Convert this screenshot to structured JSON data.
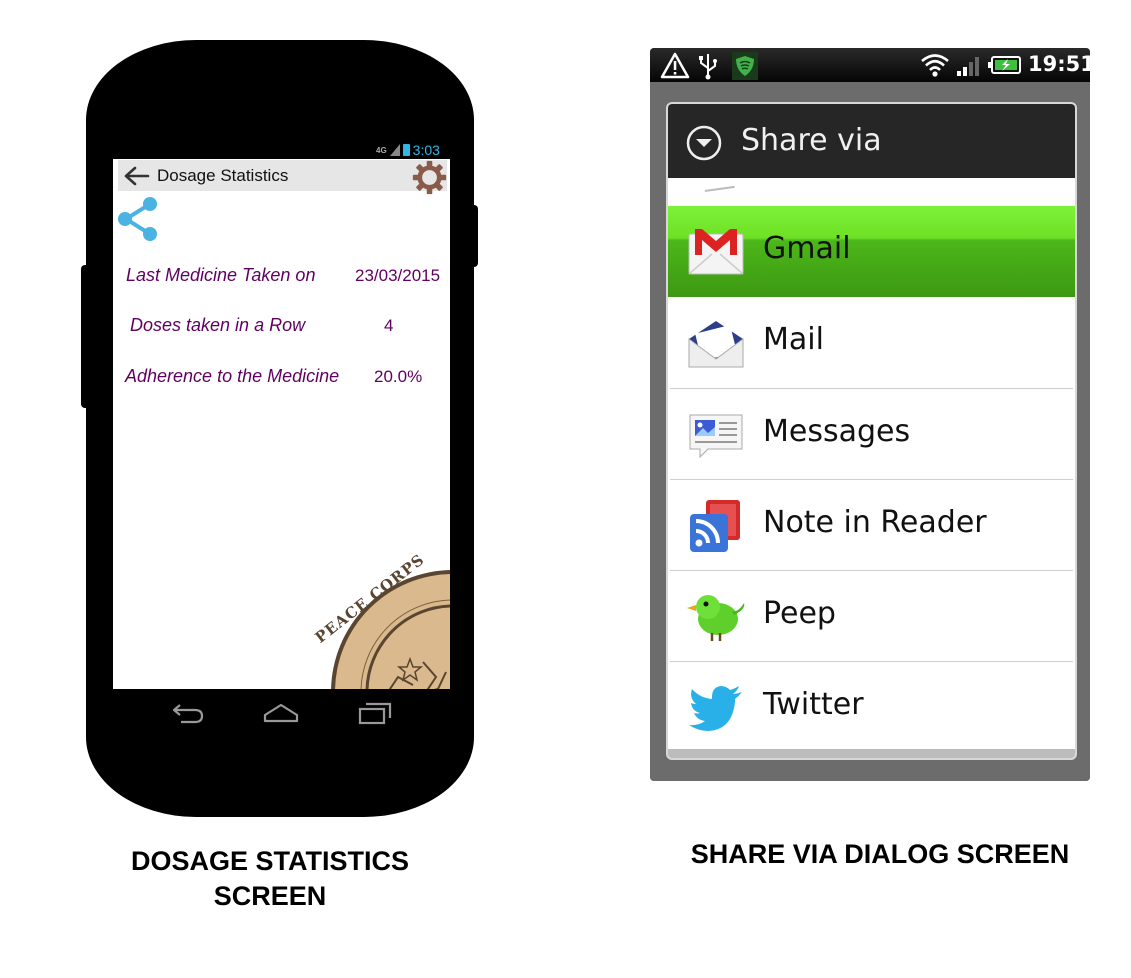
{
  "dosage_screen": {
    "status_bar": {
      "network": "4G",
      "time": "3:03"
    },
    "title": "Dosage Statistics",
    "stats": [
      {
        "label": "Last Medicine Taken on",
        "value": "23/03/2015"
      },
      {
        "label": "Doses taken in a Row",
        "value": "4"
      },
      {
        "label": "Adherence to the Medicine",
        "value": "20.0%"
      }
    ],
    "seal_text": "PEACE CORPS",
    "caption_line1": "DOSAGE STATISTICS",
    "caption_line2": "SCREEN"
  },
  "share_screen": {
    "status_bar": {
      "time": "19:51"
    },
    "dialog_title": "Share via",
    "items": [
      {
        "label": "Gmail",
        "icon": "gmail-icon",
        "selected": true
      },
      {
        "label": "Mail",
        "icon": "mail-icon",
        "selected": false
      },
      {
        "label": "Messages",
        "icon": "messages-icon",
        "selected": false
      },
      {
        "label": "Note in Reader",
        "icon": "reader-icon",
        "selected": false
      },
      {
        "label": "Peep",
        "icon": "peep-icon",
        "selected": false
      },
      {
        "label": "Twitter",
        "icon": "twitter-icon",
        "selected": false
      }
    ],
    "caption": "SHARE VIA DIALOG SCREEN"
  },
  "colors": {
    "stat_text": "#600060",
    "share_icon": "#4ab3e3",
    "selection_green": "#6ee025",
    "status_blue": "#33b5e5"
  }
}
